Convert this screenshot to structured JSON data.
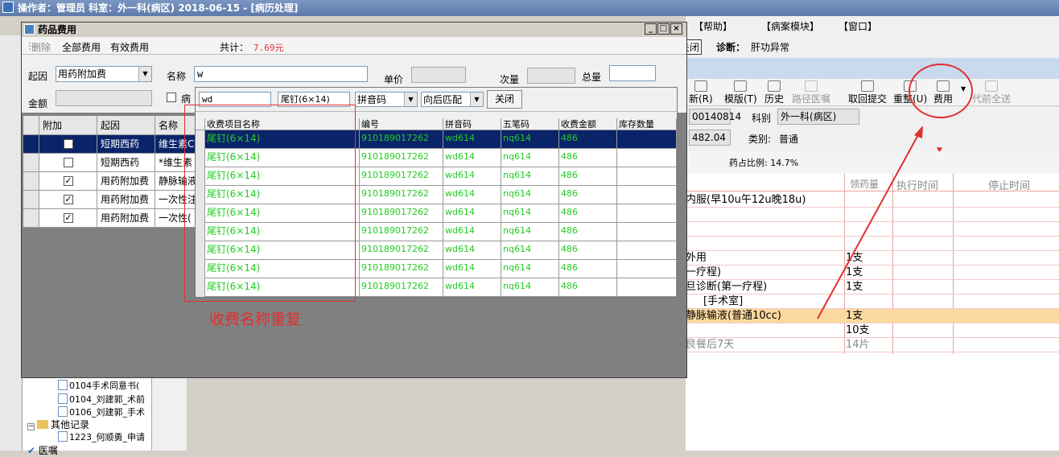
{
  "main_window": {
    "title": "操作者：管理员  科室：外一科(病区)  2018-06-15 - [病历处理]"
  },
  "menu": [
    "【帮助】",
    "【病案模块】",
    "【窗口】"
  ],
  "info_bar": {
    "close_label": "关闭",
    "diagnosis_label": "诊断：",
    "diagnosis_value": "肝功异常"
  },
  "toolbar": {
    "items": [
      {
        "label": "新(R)",
        "icon": "new-icon",
        "enabled": true
      },
      {
        "label": "模版(T)",
        "icon": "book-icon",
        "enabled": true
      },
      {
        "label": "历史",
        "icon": "history-icon",
        "enabled": true
      },
      {
        "label": "路径医嘱",
        "icon": "path-icon",
        "enabled": false
      },
      {
        "label": "取回提交",
        "icon": "retrieve-icon",
        "enabled": true
      },
      {
        "label": "重整(U)",
        "icon": "reorganize-icon",
        "enabled": true
      },
      {
        "label": "费用",
        "icon": "calculator-icon",
        "enabled": true
      },
      {
        "label": "代前全送",
        "icon": "send-icon",
        "enabled": false
      }
    ]
  },
  "patient": {
    "id_value": "00140814",
    "dept_label": "科别",
    "dept_value": "外一科(病区)",
    "amount_value": "482.04",
    "category_label": "类别:",
    "category_value": "普通",
    "ratio_label": "药占比例: 14.7%"
  },
  "orders": {
    "headers": [
      "领药量",
      "执行时间",
      "停止时间"
    ],
    "rows": [
      {
        "text": "内服(早10u午12u晚18u)",
        "qty": "",
        "highlight": false
      },
      {
        "text": "",
        "qty": "",
        "highlight": false
      },
      {
        "text": "",
        "qty": "",
        "highlight": false
      },
      {
        "text": "",
        "qty": "",
        "highlight": false
      },
      {
        "text": "外用",
        "qty": "1支",
        "highlight": false
      },
      {
        "text": "一疗程)",
        "qty": "1支",
        "highlight": false
      },
      {
        "text": "旦诊断(第一疗程)",
        "qty": "1支",
        "highlight": false
      },
      {
        "text": "[手术室]",
        "qty": "",
        "highlight": false
      },
      {
        "text": "静脉输液(普通10cc)",
        "qty": "1支",
        "highlight": true
      },
      {
        "text": "",
        "qty": "10支",
        "highlight": false
      },
      {
        "text": "艮餐后7天",
        "qty": "14片",
        "highlight": false
      }
    ]
  },
  "tree": {
    "items": [
      "0104手术同意书(",
      "0104_刘建郭_术前",
      "0106_刘建郭_手术",
      "其他记录",
      "1223_何顺勇_申请",
      "医嘱"
    ]
  },
  "dialog": {
    "title": "药品费用",
    "toolbar": {
      "delete": "删除",
      "all_fees": "全部费用",
      "valid_fees": "有效费用",
      "total_label": "共计：",
      "total_value": "7.69元"
    },
    "form": {
      "reason_label": "起因",
      "reason_value": "用药附加费",
      "name_label": "名称",
      "name_value": "w",
      "unit_price_label": "单价",
      "per_qty_label": "次量",
      "total_qty_label": "总量",
      "amount_label": "金额",
      "checkbox_label": "病"
    },
    "fee_table": {
      "headers": [
        "附加",
        "起因",
        "名称"
      ],
      "rows": [
        {
          "checked": false,
          "reason": "短期西药",
          "name": "维生素C",
          "selected": true
        },
        {
          "checked": false,
          "reason": "短期西药",
          "name": "*维生素",
          "selected": false
        },
        {
          "checked": true,
          "reason": "用药附加费",
          "name": "静脉输液",
          "selected": false
        },
        {
          "checked": true,
          "reason": "用药附加费",
          "name": "一次性注",
          "selected": false
        },
        {
          "checked": true,
          "reason": "用药附加费",
          "name": "一次性(",
          "selected": false
        }
      ]
    }
  },
  "lookup": {
    "search_value": "wd",
    "selected_name": "尾钉(6×14)",
    "mode": "拼音码",
    "match": "向后匹配",
    "close_label": "关闭",
    "headers": [
      "收费项目名称",
      "编号",
      "拼音码",
      "五笔码",
      "收费金额",
      "库存数量"
    ],
    "rows": [
      {
        "name": "尾钉(6×14)",
        "code": "910189017262",
        "pinyin": "wd614",
        "wubi": "nq614",
        "price": "486",
        "stock": ""
      },
      {
        "name": "尾钉(6×14)",
        "code": "910189017262",
        "pinyin": "wd614",
        "wubi": "nq614",
        "price": "486",
        "stock": ""
      },
      {
        "name": "尾钉(6×14)",
        "code": "910189017262",
        "pinyin": "wd614",
        "wubi": "nq614",
        "price": "486",
        "stock": ""
      },
      {
        "name": "尾钉(6×14)",
        "code": "910189017262",
        "pinyin": "wd614",
        "wubi": "nq614",
        "price": "486",
        "stock": ""
      },
      {
        "name": "尾钉(6×14)",
        "code": "910189017262",
        "pinyin": "wd614",
        "wubi": "nq614",
        "price": "486",
        "stock": ""
      },
      {
        "name": "尾钉(6×14)",
        "code": "910189017262",
        "pinyin": "wd614",
        "wubi": "nq614",
        "price": "486",
        "stock": ""
      },
      {
        "name": "尾钉(6×14)",
        "code": "910189017262",
        "pinyin": "wd614",
        "wubi": "nq614",
        "price": "486",
        "stock": ""
      },
      {
        "name": "尾钉(6×14)",
        "code": "910189017262",
        "pinyin": "wd614",
        "wubi": "nq614",
        "price": "486",
        "stock": ""
      },
      {
        "name": "尾钉(6×14)",
        "code": "910189017262",
        "pinyin": "wd614",
        "wubi": "nq614",
        "price": "486",
        "stock": ""
      }
    ]
  },
  "annotation": {
    "label": "收费名称重复",
    "color": "#e03030"
  },
  "colors": {
    "selection": "#0a246a",
    "lookup_text": "#22cc22",
    "order_highlight": "#fcd9a0"
  }
}
